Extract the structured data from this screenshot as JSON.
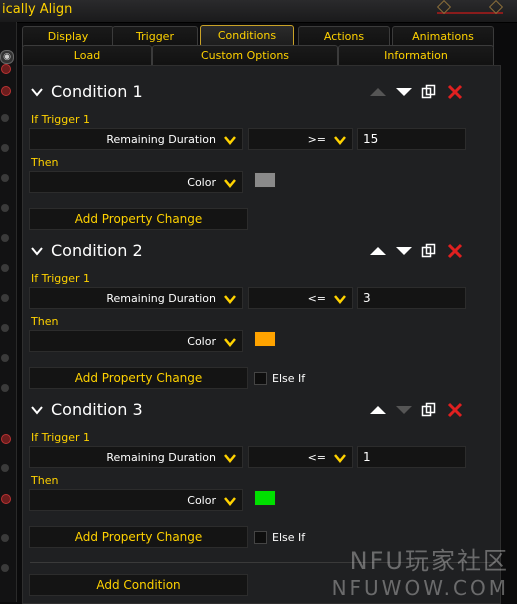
{
  "window": {
    "title": "ically Align"
  },
  "tabs_row1": [
    "Display",
    "Trigger",
    "Conditions",
    "Actions",
    "Animations"
  ],
  "tabs_row2": [
    "Load",
    "Custom Options",
    "Information"
  ],
  "active_tab": "Conditions",
  "conditions": [
    {
      "title": "Condition 1",
      "if_label": "If Trigger 1",
      "property": "Remaining Duration",
      "operator": ">=",
      "value": "15",
      "then_label": "Then",
      "then_property": "Color",
      "color": "#8a8a8a",
      "add_label": "Add Property Change",
      "else_if": null
    },
    {
      "title": "Condition 2",
      "if_label": "If Trigger 1",
      "property": "Remaining Duration",
      "operator": "<=",
      "value": "3",
      "then_label": "Then",
      "then_property": "Color",
      "color": "#ffa300",
      "add_label": "Add Property Change",
      "else_if": "Else If"
    },
    {
      "title": "Condition 3",
      "if_label": "If Trigger 1",
      "property": "Remaining Duration",
      "operator": "<=",
      "value": "1",
      "then_label": "Then",
      "then_property": "Color",
      "color": "#00e000",
      "add_label": "Add Property Change",
      "else_if": "Else If"
    }
  ],
  "add_condition": "Add Condition",
  "watermark": {
    "line1": "NFU玩家社区",
    "line2": "NFUWOW.COM"
  },
  "colors": {
    "gold": "#ffd200",
    "delete": "#e02020",
    "dim_arrow": "#555555"
  }
}
